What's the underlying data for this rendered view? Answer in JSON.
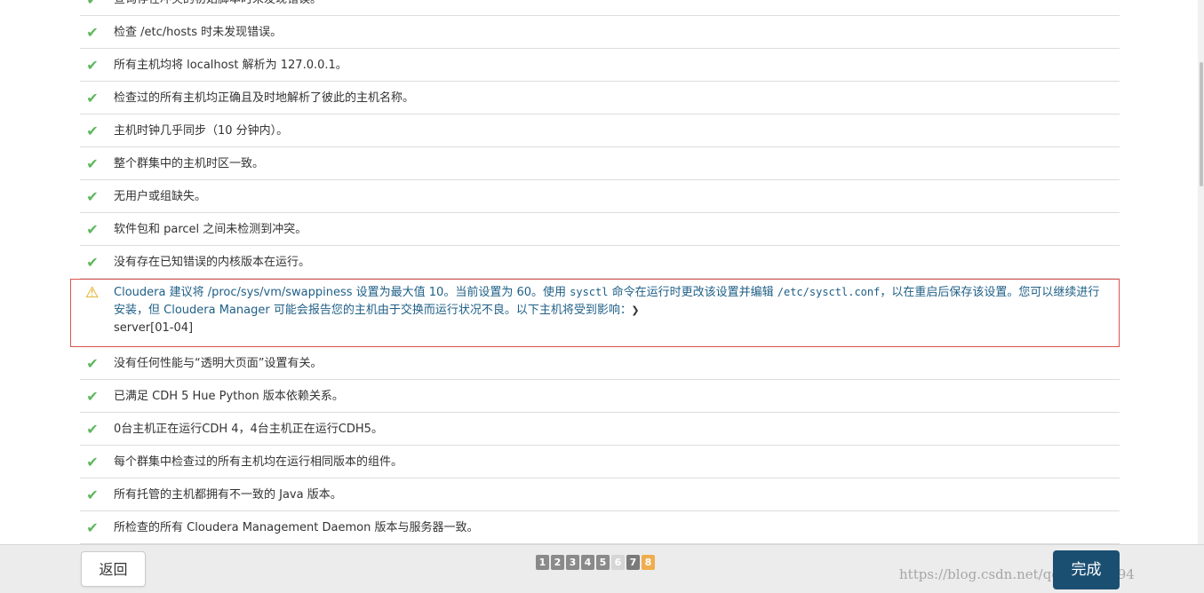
{
  "checks": [
    {
      "text": "查询存在冲突的初始脚本时未发现错误。"
    },
    {
      "text": "检查 /etc/hosts 时未发现错误。"
    },
    {
      "text": "所有主机均将 localhost 解析为 127.0.0.1。"
    },
    {
      "text": "检查过的所有主机均正确且及时地解析了彼此的主机名称。"
    },
    {
      "text": "主机时钟几乎同步（10 分钟内）。"
    },
    {
      "text": "整个群集中的主机时区一致。"
    },
    {
      "text": "无用户或组缺失。"
    },
    {
      "text": "软件包和 parcel 之间未检测到冲突。"
    },
    {
      "text": "没有存在已知错误的内核版本在运行。"
    }
  ],
  "warning": {
    "part1": "Cloudera 建议将 /proc/sys/vm/swappiness 设置为最大值 10。当前设置为 60。使用 ",
    "cmd1": "sysctl",
    "part2": " 命令在运行时更改该设置并编辑 ",
    "cmd2": "/etc/sysctl.conf",
    "part3": "，以在重启后保存该设置。您可以继续进行安装，但 Cloudera Manager 可能会报告您的主机由于交换而运行状况不良。以下主机将受到影响：",
    "hosts": "server[01-04]",
    "icon": "warning-triangle-icon",
    "border_color": "#d9534f",
    "text_color": "#1f5f86"
  },
  "checks_after": [
    {
      "text": "没有任何性能与“透明大页面”设置有关。"
    },
    {
      "text": "已满足 CDH 5 Hue Python 版本依赖关系。"
    },
    {
      "text": "0台主机正在运行CDH 4，4台主机正在运行CDH5。"
    },
    {
      "text": "每个群集中检查过的所有主机均在运行相同版本的组件。"
    },
    {
      "text": "所有托管的主机都拥有不一致的 Java 版本。"
    },
    {
      "text": "所检查的所有 Cloudera Management Daemon 版本与服务器一致。"
    }
  ],
  "check_icon": "check-icon",
  "check_color": "#5cb85c",
  "footer": {
    "back_label": "返回",
    "finish_label": "完成",
    "pages": [
      "1",
      "2",
      "3",
      "4",
      "5",
      "6",
      "7",
      "8"
    ],
    "current_page": "8",
    "watermark": "https://blog.csdn.net/qq_38344394"
  }
}
